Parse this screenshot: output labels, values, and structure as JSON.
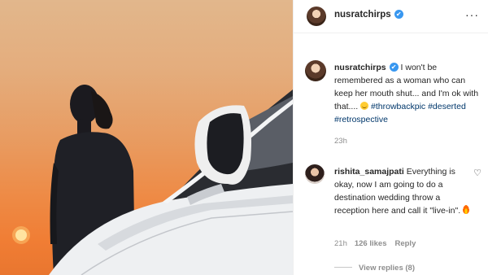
{
  "post": {
    "username": "nusratchirps",
    "verified_mark": "✔",
    "more_label": "···",
    "caption_user": "nusratchirps",
    "caption_text": " I won't be remembered as a woman who can keep her mouth shut... and I'm ok with that.... ",
    "hashtags": [
      "#throwbackpic",
      "#deserted",
      "#retrospective"
    ],
    "time": "23h"
  },
  "comment": {
    "username": "rishita_samajpati",
    "text": " Everything is okay, now I am going to do a destination wedding throw a reception here and call it \"live-in\". ",
    "time": "21h",
    "likes": "126 likes",
    "reply_label": "Reply",
    "view_replies": "View replies (8)",
    "heart_icon": "♡"
  },
  "photo": {
    "description_icon": "sunset-photo",
    "accent_sky": "#e89c62"
  }
}
